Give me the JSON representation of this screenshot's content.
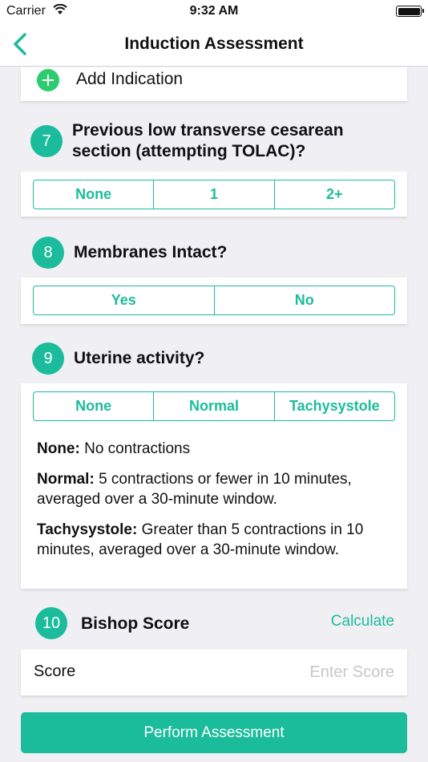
{
  "status_bar": {
    "carrier": "Carrier",
    "time": "9:32 AM"
  },
  "nav": {
    "title": "Induction Assessment"
  },
  "add_indication": {
    "label": "Add Indication"
  },
  "questions": [
    {
      "number": "7",
      "text": "Previous low transverse cesarean section (attempting TOLAC)?",
      "options": [
        "None",
        "1",
        "2+"
      ]
    },
    {
      "number": "8",
      "text": "Membranes Intact?",
      "options": [
        "Yes",
        "No"
      ]
    },
    {
      "number": "9",
      "text": "Uterine activity?",
      "options": [
        "None",
        "Normal",
        "Tachysystole"
      ],
      "descriptions": [
        {
          "term": "None:",
          "text": " No contractions"
        },
        {
          "term": "Normal:",
          "text": " 5 contractions or fewer in 10 minutes, averaged over a 30-minute window."
        },
        {
          "term": "Tachysystole:",
          "text": " Greater than 5 contractions in 10 minutes, averaged over a 30-minute window."
        }
      ]
    }
  ],
  "bishop": {
    "number": "10",
    "title": "Bishop Score",
    "calculate_label": "Calculate"
  },
  "score": {
    "label": "Score",
    "placeholder": "Enter Score"
  },
  "perform_button": {
    "label": "Perform Assessment"
  },
  "colors": {
    "accent": "#1bbc9b",
    "add_green": "#2ecc71",
    "background": "#efeff4"
  }
}
